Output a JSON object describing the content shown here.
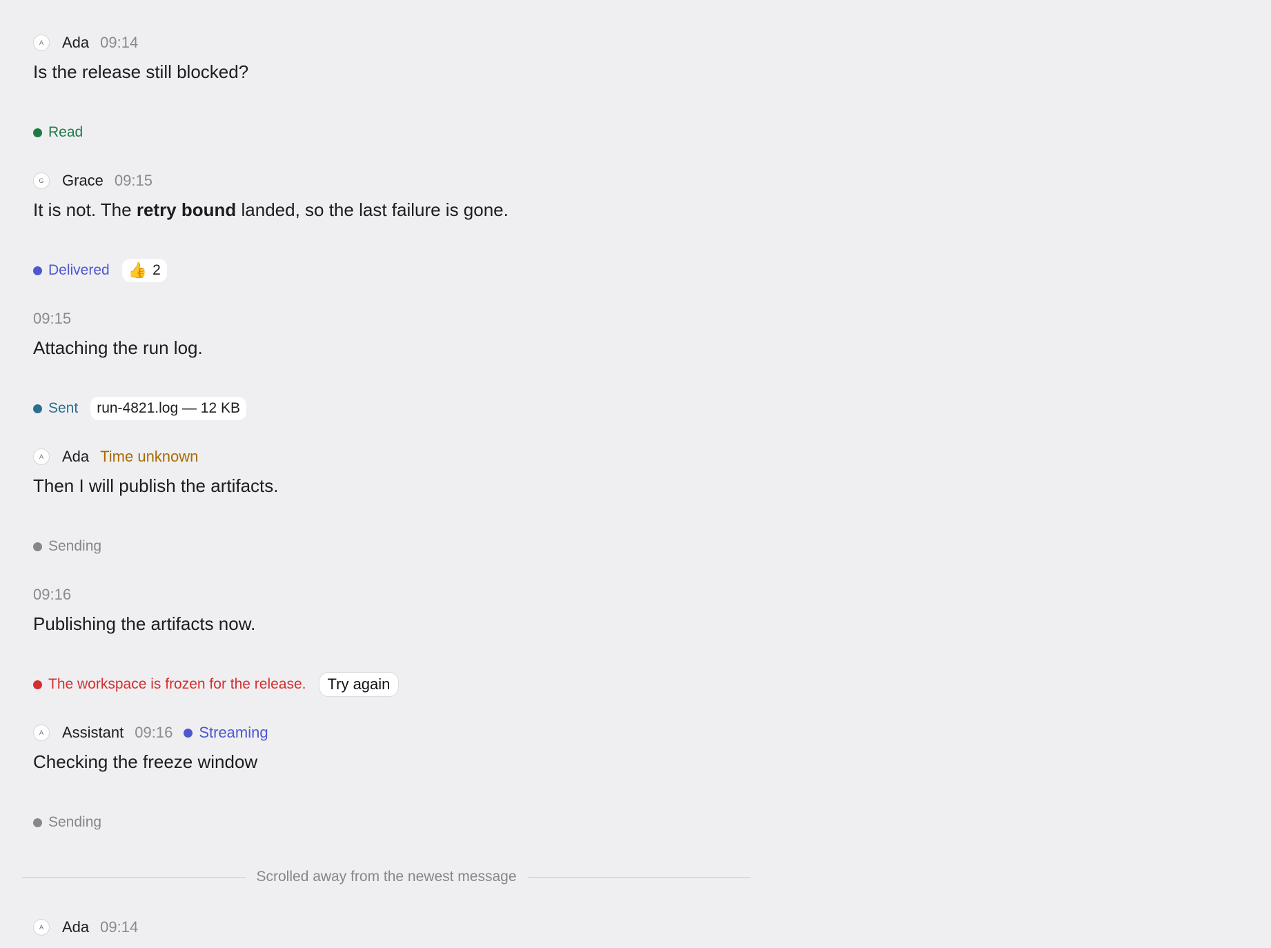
{
  "messages": [
    {
      "author": "Ada",
      "avatar": "A",
      "time": "09:14",
      "text": "Is the release still blocked?",
      "status": "Read"
    },
    {
      "author": "Grace",
      "avatar": "G",
      "time": "09:15",
      "text_pre": "It is not. The ",
      "text_bold": "retry bound",
      "text_post": " landed, so the last failure is gone.",
      "status": "Delivered",
      "reaction": {
        "emoji": "👍",
        "count": "2"
      }
    },
    {
      "time": "09:15",
      "text": "Attaching the run log.",
      "status": "Sent",
      "attachment": "run-4821.log — 12 KB"
    },
    {
      "author": "Ada",
      "avatar": "A",
      "time": "Time unknown",
      "text": "Then I will publish the artifacts.",
      "status": "Sending"
    },
    {
      "time": "09:16",
      "text": "Publishing the artifacts now.",
      "error": "The workspace is frozen for the release.",
      "retry_label": "Try again"
    },
    {
      "author": "Assistant",
      "avatar": "A",
      "time": "09:16",
      "stream_status": "Streaming",
      "text": "Checking the freeze window",
      "status": "Sending"
    },
    {
      "author": "Ada",
      "avatar": "A",
      "time": "09:14"
    }
  ],
  "divider_label": "Scrolled away from the newest message",
  "colors": {
    "read": "#1e7a45",
    "delivered": "#4f56d1",
    "sent": "#2a6f8f",
    "sending": "#86868b",
    "error": "#d42f2f",
    "time_unknown": "#a86a00",
    "streaming": "#4f56d1"
  }
}
